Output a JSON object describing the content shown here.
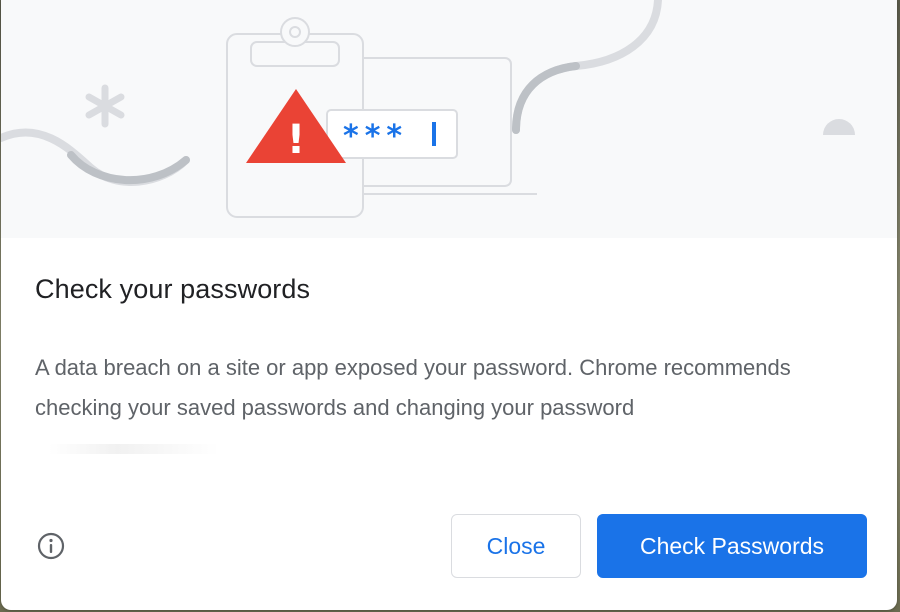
{
  "dialog": {
    "title": "Check your passwords",
    "body": "A data breach on a site or app exposed your password. Chrome recommends checking your saved passwords and changing your password",
    "illustration": {
      "masked_password": "***",
      "warning_symbol": "!",
      "warning_color": "#ea4335",
      "accent_color": "#1a73e8"
    }
  },
  "footer": {
    "info_icon": "info-icon",
    "close_label": "Close",
    "primary_label": "Check Passwords"
  },
  "colors": {
    "primary": "#1a73e8",
    "title_text": "#202124",
    "body_text": "#5f6368",
    "hero_background": "#f8f9fa"
  }
}
